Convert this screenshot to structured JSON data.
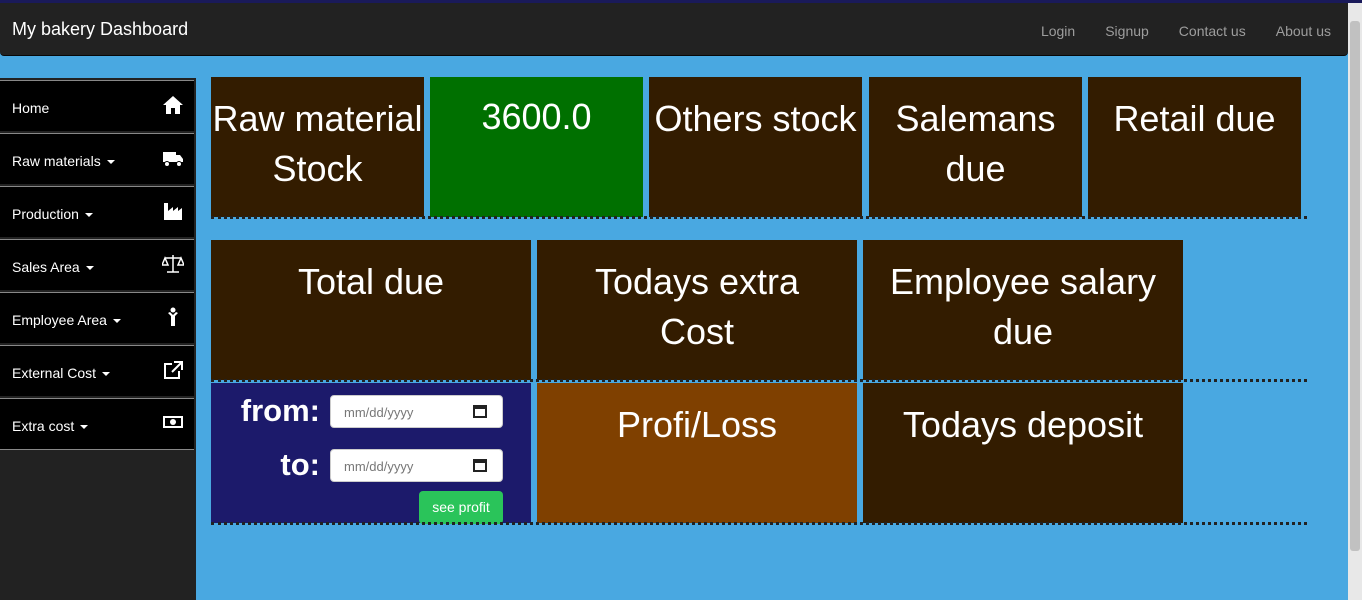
{
  "navbar": {
    "brand": "My bakery Dashboard",
    "links": [
      "Login",
      "Signup",
      "Contact us",
      "About us"
    ]
  },
  "sidebar": {
    "items": [
      {
        "label": "Home",
        "icon": "home-icon"
      },
      {
        "label": "Raw materials",
        "icon": "truck-icon"
      },
      {
        "label": "Production",
        "icon": "factory-icon"
      },
      {
        "label": "Sales Area",
        "icon": "scale-icon"
      },
      {
        "label": "Employee Area",
        "icon": "person-icon"
      },
      {
        "label": "External Cost",
        "icon": "external-link-icon"
      },
      {
        "label": "Extra cost",
        "icon": "money-icon"
      }
    ]
  },
  "tiles": {
    "raw_material_stock": "Raw material Stock",
    "stock_value": "3600.0",
    "others_stock": "Others stock",
    "salemans_due": "Salemans due",
    "retail_due": "Retail due",
    "total_due": "Total due",
    "todays_extra_cost": "Todays extra Cost",
    "employee_salary_due": "Employee salary due",
    "profit_loss": "Profi/Loss",
    "todays_deposit": "Todays deposit"
  },
  "profit_form": {
    "from_label": "from:",
    "to_label": "to:",
    "date_placeholder": "mm/dd/yyyy",
    "button_label": "see profit"
  },
  "colors": {
    "background": "#49a8e1",
    "tile_dark": "#331c00",
    "tile_green": "#007000",
    "tile_orange": "#7f4000",
    "form_bg": "#1c1a6b",
    "button": "#2ac45a"
  }
}
